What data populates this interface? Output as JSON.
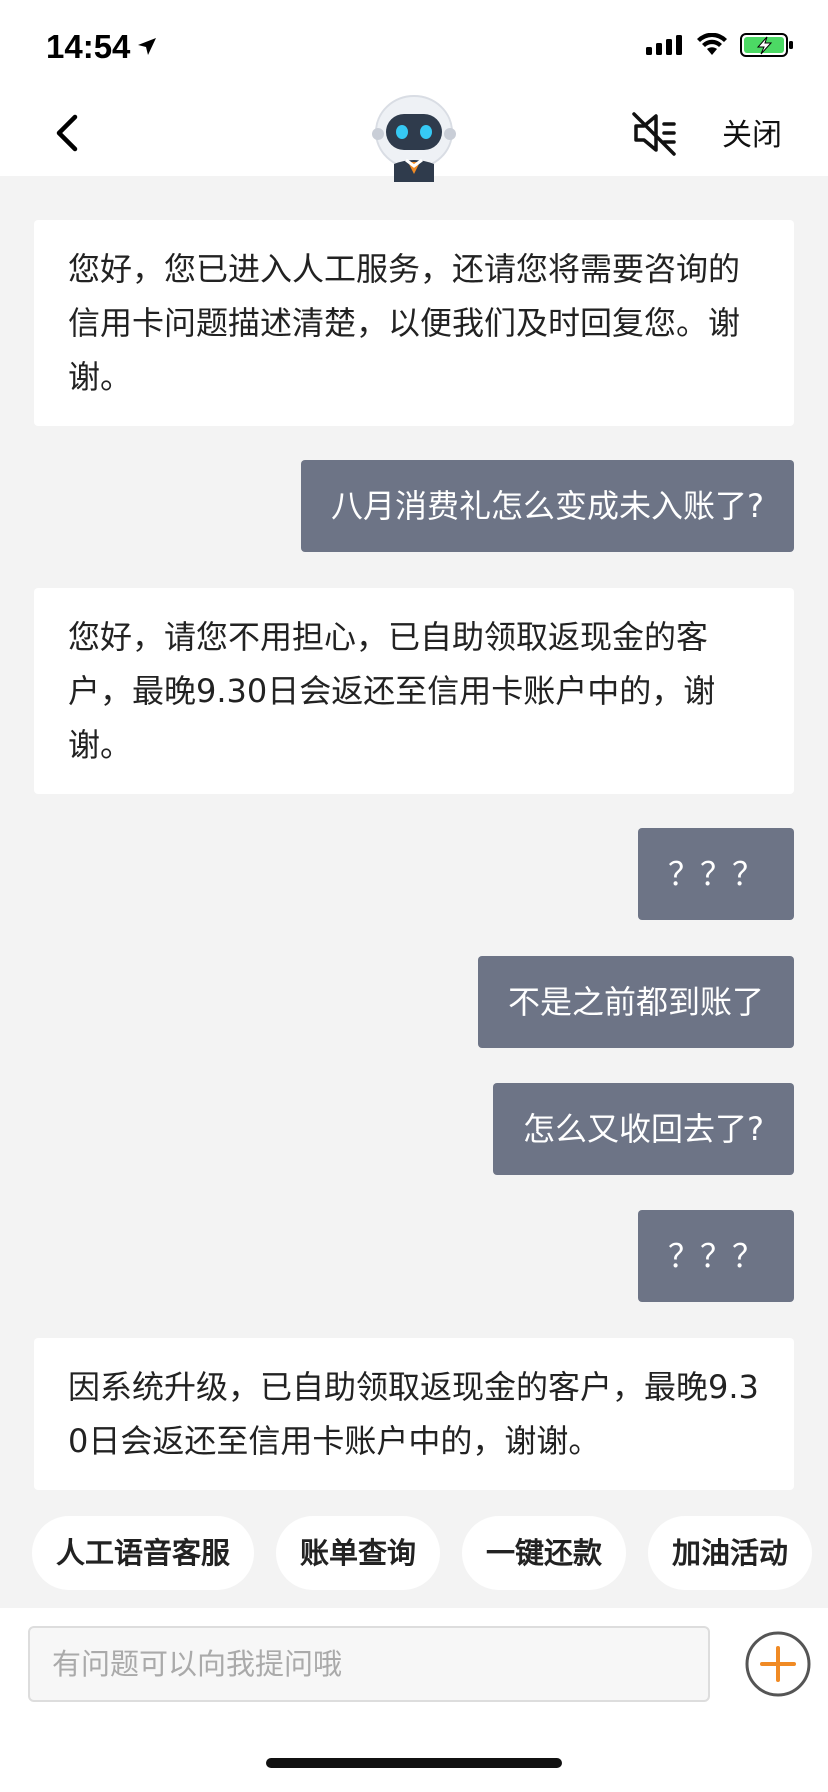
{
  "status_bar": {
    "time": "14:54"
  },
  "header": {
    "close_label": "关闭"
  },
  "messages": [
    {
      "role": "agent",
      "text": "您好，您已进入人工服务，还请您将需要咨询的信用卡问题描述清楚，以便我们及时回复您。谢谢。"
    },
    {
      "role": "user",
      "text": "八月消费礼怎么变成未入账了?"
    },
    {
      "role": "agent",
      "text": "您好，请您不用担心，已自助领取返现金的客户，最晚9.30日会返还至信用卡账户中的，谢谢。"
    },
    {
      "role": "user",
      "text": "？？？"
    },
    {
      "role": "user",
      "text": "不是之前都到账了"
    },
    {
      "role": "user",
      "text": "怎么又收回去了?"
    },
    {
      "role": "user",
      "text": "？？？"
    },
    {
      "role": "agent",
      "text": "因系统升级，已自助领取返现金的客户，最晚9.30日会返还至信用卡账户中的，谢谢。"
    }
  ],
  "quick_replies": [
    {
      "label": "人工语音客服"
    },
    {
      "label": "账单查询"
    },
    {
      "label": "一键还款"
    },
    {
      "label": "加油活动"
    }
  ],
  "input": {
    "placeholder": "有问题可以向我提问哦"
  },
  "colors": {
    "user_bubble": "#6d7486",
    "agent_bubble": "#ffffff",
    "background": "#f3f3f3",
    "accent": "#f08a24",
    "battery": "#4cd964"
  }
}
